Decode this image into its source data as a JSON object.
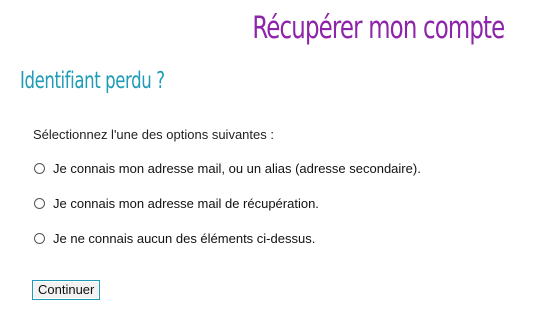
{
  "header": {
    "title": "Récupérer mon compte"
  },
  "section": {
    "title": "Identifiant perdu ?"
  },
  "form": {
    "instructions": "Sélectionnez l'une des options suivantes :",
    "options": [
      {
        "label": "Je connais mon adresse mail, ou un alias (adresse secondaire).",
        "selected": false
      },
      {
        "label": "Je connais mon adresse mail de récupération.",
        "selected": false
      },
      {
        "label": "Je ne connais aucun des éléments ci-dessus.",
        "selected": false
      }
    ],
    "submit_label": "Continuer"
  },
  "colors": {
    "title": "#8e24aa",
    "section_title": "#1e9bb5",
    "button_border": "#1e9bb5"
  }
}
